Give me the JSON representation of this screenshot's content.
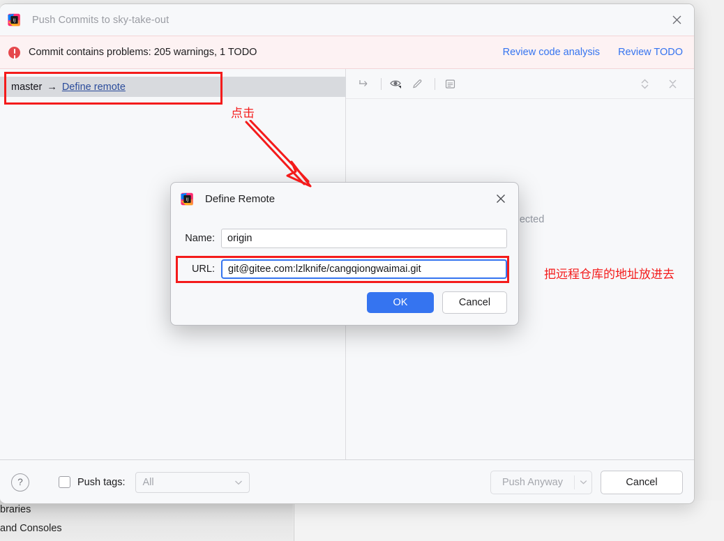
{
  "ide_background": {
    "line1": "braries",
    "line2": "and Consoles"
  },
  "push_window": {
    "title": "Push Commits to sky-take-out",
    "logo_icon": "intellij-idea-logo",
    "close_icon": "close-icon",
    "warning": {
      "icon": "error-circle-icon",
      "text": "Commit contains problems: 205 warnings, 1 TODO",
      "links": [
        {
          "label": "Review code analysis"
        },
        {
          "label": "Review TODO"
        }
      ]
    },
    "branch_row": {
      "branch": "master",
      "arrow": "→",
      "link_label": "Define remote"
    },
    "commit_panel": {
      "toolbar": [
        {
          "icon": "collapse-to-left-icon",
          "name": "show-diff-icon"
        },
        {
          "icon": "eye-icon",
          "name": "preview-icon"
        },
        {
          "icon": "pencil-icon",
          "name": "edit-icon"
        },
        {
          "icon": "document-icon",
          "name": "details-icon"
        }
      ],
      "toolbar_right": [
        {
          "icon": "expand-all-icon"
        },
        {
          "icon": "collapse-all-icon"
        }
      ],
      "empty_message": "ts selected"
    },
    "footer": {
      "help_label": "?",
      "push_tags_label": "Push tags:",
      "push_tags_value": "All",
      "push_tags_checked": false,
      "push_anyway_label": "Push Anyway",
      "push_anyway_chevron": "chevron-down-icon",
      "cancel_label": "Cancel"
    }
  },
  "define_remote_dialog": {
    "logo_icon": "intellij-idea-logo",
    "title": "Define Remote",
    "close_icon": "close-icon",
    "fields": [
      {
        "label": "Name:",
        "value": "origin",
        "focused": false
      },
      {
        "label": "URL:",
        "value": "git@gitee.com:lzlknife/cangqiongwaimai.git",
        "focused": true
      }
    ],
    "ok_label": "OK",
    "cancel_label": "Cancel"
  },
  "annotations": {
    "click_note": "点击",
    "url_note": "把远程仓库的地址放进去",
    "color": "#f41b1b"
  },
  "colors": {
    "accent_blue": "#3574f0",
    "link_blue": "#2b4c9b",
    "warning_bg": "#fdf2f3",
    "warning_red": "#e5484d",
    "selection_gray": "#d8dade",
    "annotation_red": "#f41b1b"
  }
}
